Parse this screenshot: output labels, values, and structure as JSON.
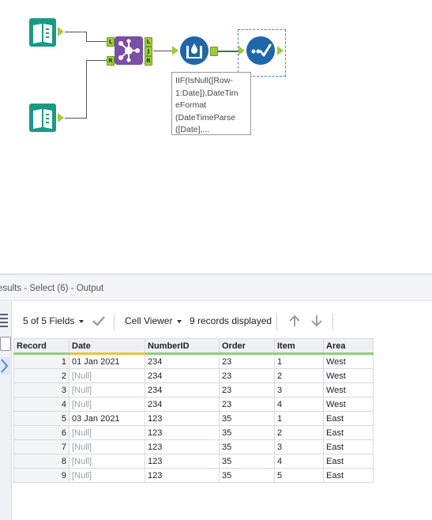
{
  "canvas": {
    "annotation": {
      "lines": [
        "IIF(IsNull([Row-",
        "1:Date]),DateTim",
        "eFormat",
        "(DateTimeParse",
        "([Date],..."
      ]
    },
    "join_anchors": {
      "left": "L",
      "right": "R",
      "out_left": "L",
      "out_join": "J",
      "out_right": "R"
    },
    "colors": {
      "input": "#1a9a84",
      "join": "#7a4fa6",
      "formula": "#1f67a8",
      "select": "#1f67a8",
      "anchor": "#9ccc3c"
    }
  },
  "results": {
    "title": "esults - Select (6) - Output",
    "fields_label": "5 of 5 Fields",
    "viewer_label": "Cell Viewer",
    "records_label": "9 records displayed",
    "columns": [
      "Record",
      "Date",
      "NumberID",
      "Order",
      "Item",
      "Area"
    ],
    "rows": [
      [
        "1",
        "01 Jan 2021",
        "234",
        "23",
        "1",
        "West"
      ],
      [
        "2",
        "[Null]",
        "234",
        "23",
        "2",
        "West"
      ],
      [
        "3",
        "[Null]",
        "234",
        "23",
        "3",
        "West"
      ],
      [
        "4",
        "[Null]",
        "234",
        "23",
        "4",
        "West"
      ],
      [
        "5",
        "03 Jan 2021",
        "123",
        "35",
        "1",
        "East"
      ],
      [
        "6",
        "[Null]",
        "123",
        "35",
        "2",
        "East"
      ],
      [
        "7",
        "[Null]",
        "123",
        "35",
        "3",
        "East"
      ],
      [
        "8",
        "[Null]",
        "123",
        "35",
        "4",
        "East"
      ],
      [
        "9",
        "[Null]",
        "123",
        "35",
        "5",
        "East"
      ]
    ]
  }
}
